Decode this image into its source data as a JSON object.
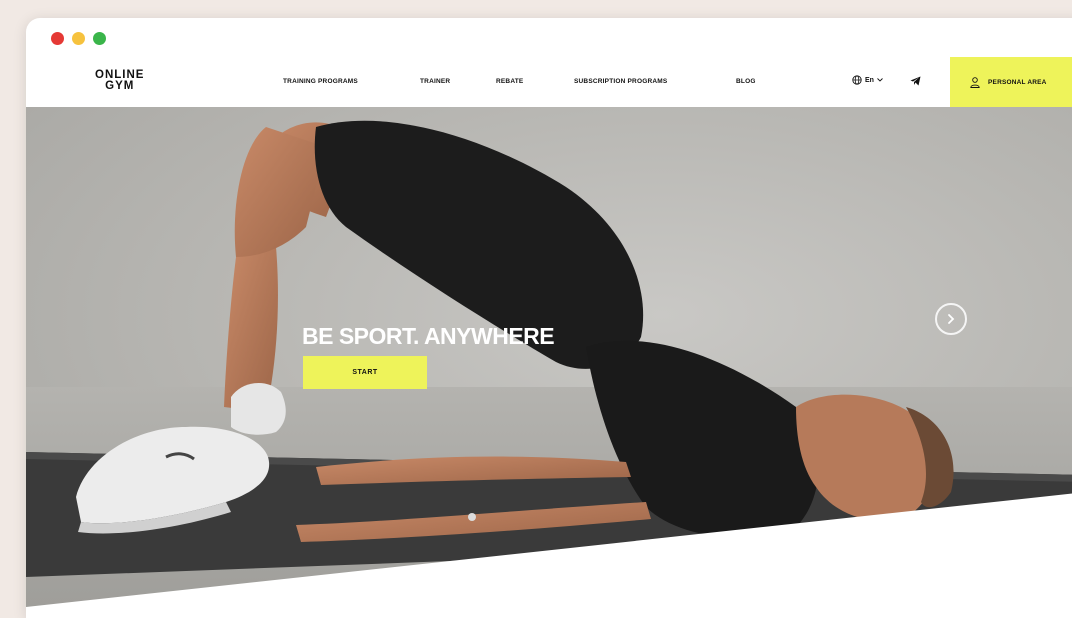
{
  "header": {
    "logo_line1": "ONLINE",
    "logo_line2": "GYM",
    "nav": [
      {
        "label": "TRAINING PROGRAMS"
      },
      {
        "label": "TRAINER"
      },
      {
        "label": "REBATE"
      },
      {
        "label": "SUBSCRIPTION PROGRAMS"
      },
      {
        "label": "BLOG"
      }
    ],
    "language": "En",
    "personal_area_label": "PERSONAL AREA"
  },
  "hero": {
    "title": "BE SPORT. ANYWHERE",
    "start_label": "START"
  },
  "colors": {
    "accent": "#eef35a",
    "dot_red": "#e53935",
    "dot_yellow": "#f6c23e",
    "dot_green": "#3ab54a",
    "page_bg": "#f1e9e4"
  },
  "icons": [
    "globe-icon",
    "chevron-down-icon",
    "telegram-icon",
    "user-icon",
    "chevron-right-icon"
  ]
}
